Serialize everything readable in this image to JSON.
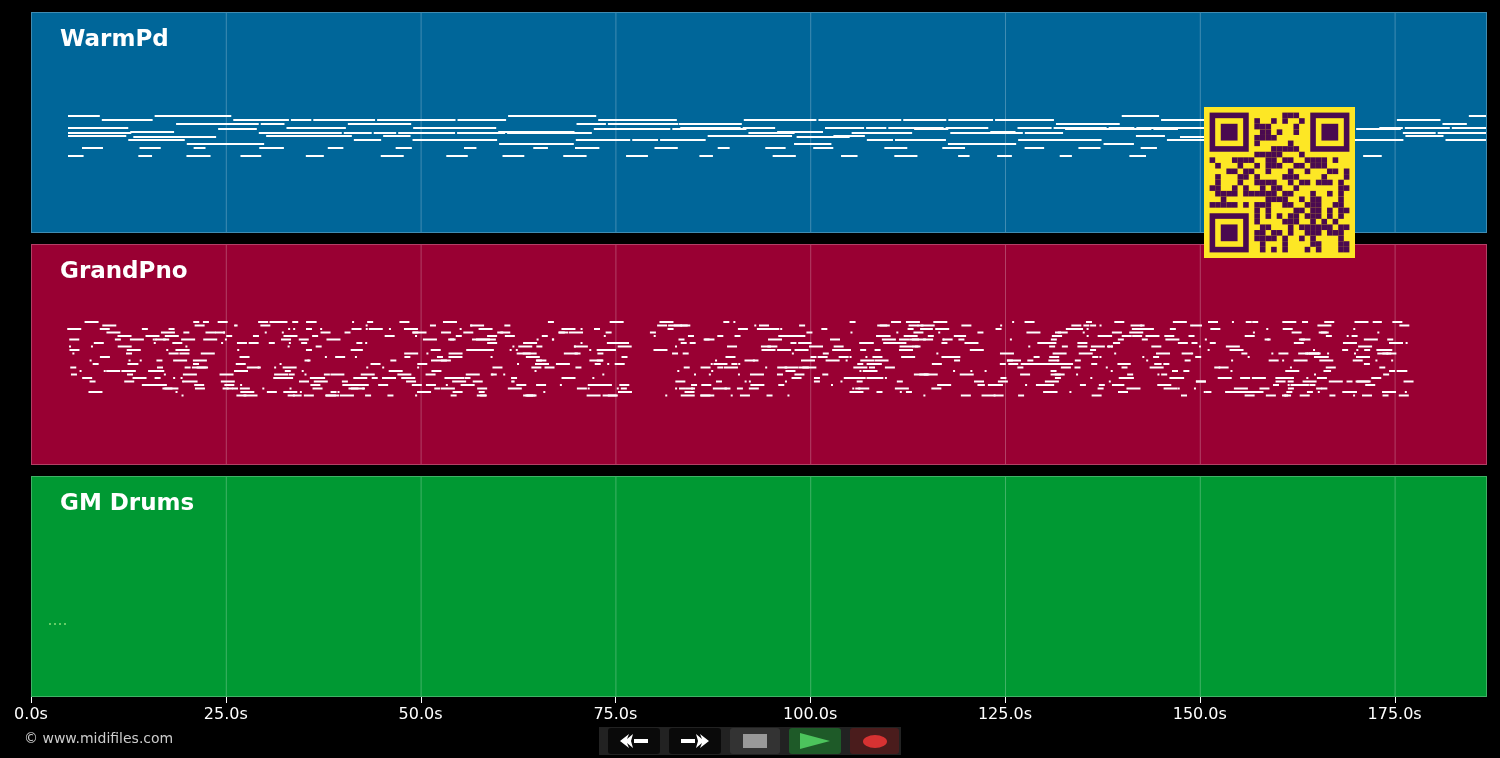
{
  "tracks": [
    {
      "name": "WarmPd",
      "kind": "pad",
      "color": "#006699"
    },
    {
      "name": "GrandPno",
      "kind": "piano",
      "color": "#990033"
    },
    {
      "name": "GM Drums",
      "kind": "drums",
      "color": "#009933"
    }
  ],
  "axis": {
    "ticks": [
      {
        "label": "0.0s"
      },
      {
        "label": "25.0s"
      },
      {
        "label": "50.0s"
      },
      {
        "label": "75.0s"
      },
      {
        "label": "100.0s"
      },
      {
        "label": "125.0s"
      },
      {
        "label": "150.0s"
      },
      {
        "label": "175.0s"
      }
    ]
  },
  "copyright": "© www.midifiles.com"
}
